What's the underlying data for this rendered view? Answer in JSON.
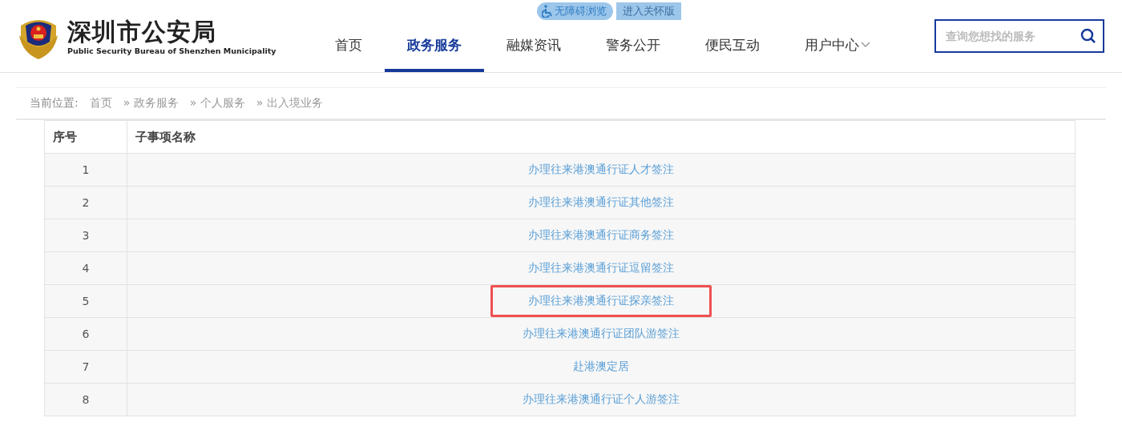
{
  "logo": {
    "title": "深圳市公安局",
    "subtitle": "Public Security Bureau of Shenzhen Municipality"
  },
  "top_links": [
    {
      "label": "无障碍浏览",
      "kind": "accessible"
    },
    {
      "label": "进入关怀版",
      "kind": "care"
    }
  ],
  "nav": [
    {
      "label": "首页",
      "selected": false,
      "dropdown": false
    },
    {
      "label": "政务服务",
      "selected": true,
      "dropdown": false
    },
    {
      "label": "融媒资讯",
      "selected": false,
      "dropdown": false
    },
    {
      "label": "警务公开",
      "selected": false,
      "dropdown": false
    },
    {
      "label": "便民互动",
      "selected": false,
      "dropdown": false
    },
    {
      "label": "用户中心",
      "selected": false,
      "dropdown": true
    }
  ],
  "search": {
    "placeholder": "查询您想找的服务"
  },
  "breadcrumb": {
    "label": "当前位置:",
    "items": [
      "首页",
      "» 政务服务",
      "» 个人服务",
      "» 出入境业务"
    ]
  },
  "table": {
    "columns": [
      "序号",
      "子事项名称"
    ],
    "rows": [
      {
        "index": "1",
        "name": "办理往来港澳通行证人才签注",
        "highlighted": false
      },
      {
        "index": "2",
        "name": "办理往来港澳通行证其他签注",
        "highlighted": false
      },
      {
        "index": "3",
        "name": "办理往来港澳通行证商务签注",
        "highlighted": false
      },
      {
        "index": "4",
        "name": "办理往来港澳通行证逗留签注",
        "highlighted": false
      },
      {
        "index": "5",
        "name": "办理往来港澳通行证探亲签注",
        "highlighted": true
      },
      {
        "index": "6",
        "name": "办理往来港澳通行证团队游签注",
        "highlighted": false
      },
      {
        "index": "7",
        "name": "赴港澳定居",
        "highlighted": false
      },
      {
        "index": "8",
        "name": "办理往来港澳通行证个人游签注",
        "highlighted": false
      }
    ]
  }
}
